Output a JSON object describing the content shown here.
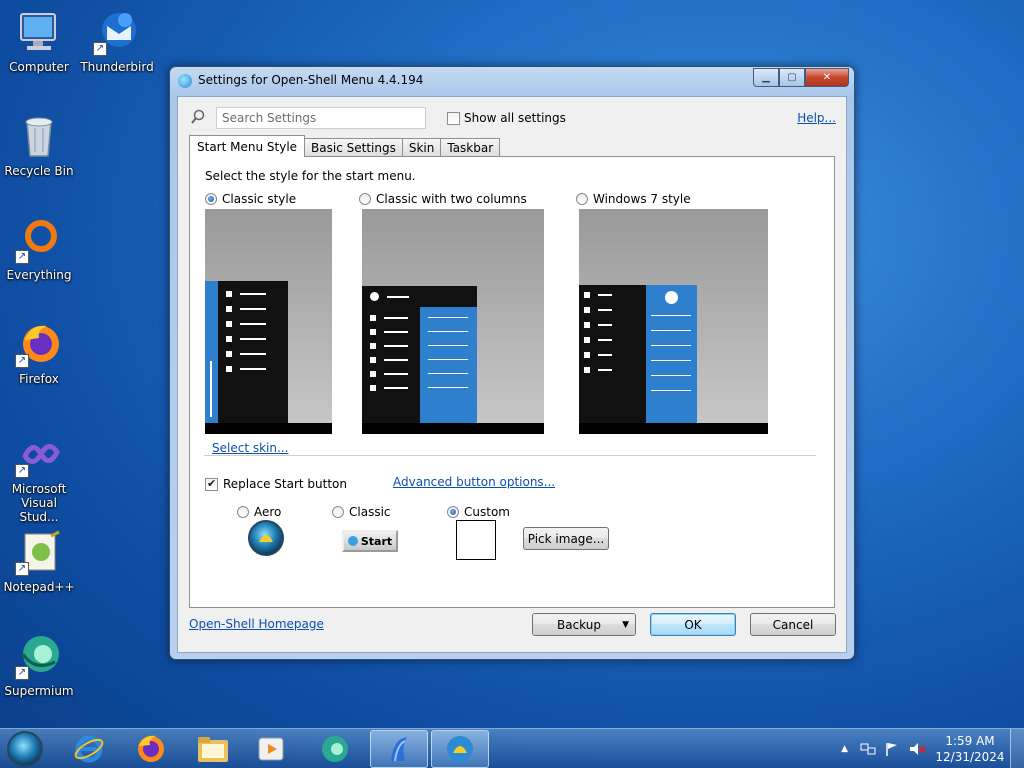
{
  "desktop": {
    "icons": [
      {
        "label": "Computer"
      },
      {
        "label": "Thunderbird"
      },
      {
        "label": "Recycle Bin"
      },
      {
        "label": "Everything"
      },
      {
        "label": "Firefox"
      },
      {
        "label": "Microsoft Visual Stud..."
      },
      {
        "label": "Notepad++"
      },
      {
        "label": "Supermium"
      }
    ]
  },
  "dialog": {
    "title": "Settings for Open-Shell Menu 4.4.194",
    "search_placeholder": "Search Settings",
    "show_all_label": "Show all settings",
    "show_all_checked": false,
    "help_label": "Help...",
    "tabs": [
      {
        "label": "Start Menu Style",
        "active": true
      },
      {
        "label": "Basic Settings",
        "active": false
      },
      {
        "label": "Skin",
        "active": false
      },
      {
        "label": "Taskbar",
        "active": false
      }
    ],
    "style_prompt": "Select the style for the start menu.",
    "styles": [
      {
        "label": "Classic style",
        "selected": true
      },
      {
        "label": "Classic with two columns",
        "selected": false
      },
      {
        "label": "Windows 7 style",
        "selected": false
      }
    ],
    "select_skin_label": "Select skin...",
    "replace_start_label": "Replace Start button",
    "replace_start_checked": true,
    "advanced_button_label": "Advanced button options...",
    "button_styles": [
      {
        "label": "Aero",
        "selected": false
      },
      {
        "label": "Classic",
        "selected": false
      },
      {
        "label": "Custom",
        "selected": true
      }
    ],
    "classic_button_text": "Start",
    "pick_image_label": "Pick image...",
    "homepage_label": "Open-Shell Homepage",
    "backup_label": "Backup",
    "ok_label": "OK",
    "cancel_label": "Cancel"
  },
  "taskbar": {
    "items": [
      "start-orb-icon",
      "internet-explorer-icon",
      "firefox-icon",
      "file-explorer-icon",
      "media-player-icon",
      "supermium-icon",
      "open-shell-icon",
      "settings-shell-icon"
    ],
    "clock_time": "1:59 AM",
    "clock_date": "12/31/2024"
  },
  "colors": {
    "accent_blue": "#2f7fcf",
    "menu_black": "#111111",
    "link": "#0d4fb0"
  }
}
